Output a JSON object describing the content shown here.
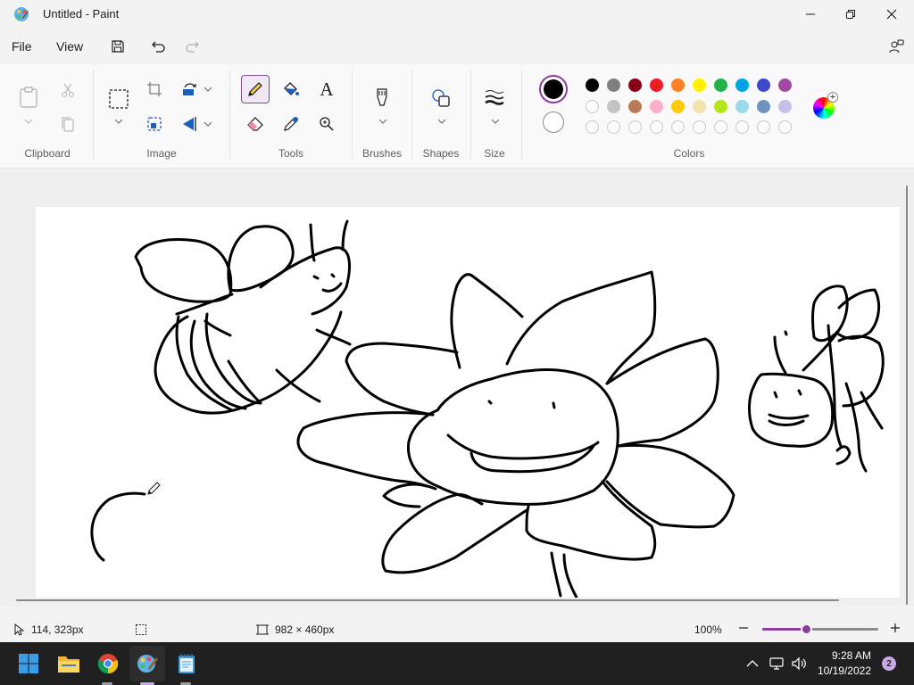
{
  "window": {
    "title": "Untitled - Paint",
    "controls": [
      "minimize",
      "maximize",
      "close"
    ]
  },
  "menu": {
    "items": [
      "File",
      "View"
    ],
    "quick_actions": [
      "save-icon",
      "undo-icon",
      "redo-icon"
    ],
    "share_icon": "share-icon"
  },
  "ribbon": {
    "groups": {
      "clipboard": "Clipboard",
      "image": "Image",
      "tools": "Tools",
      "brushes": "Brushes",
      "shapes": "Shapes",
      "size": "Size",
      "colors": "Colors"
    },
    "active_tool": "pencil",
    "text_tool_label": "A"
  },
  "colors": {
    "primary": "#000000",
    "secondary": "#ffffff",
    "palette_row1": [
      "#000000",
      "#7f7f7f",
      "#880015",
      "#ed1c24",
      "#ff7f27",
      "#fff200",
      "#22b14c",
      "#00a2e8",
      "#3f48cc",
      "#a349a4"
    ],
    "palette_row2": [
      "#ffffff",
      "#c3c3c3",
      "#b97a57",
      "#ffaec9",
      "#ffc90e",
      "#efe4b0",
      "#b5e61d",
      "#99d9ea",
      "#7092be",
      "#c8bfe7"
    ],
    "palette_row3_empty": 10,
    "accent": "#8a3d9c"
  },
  "status": {
    "cursor_pos": "114, 323px",
    "canvas_size": "982 × 460px",
    "zoom": "100%",
    "zoom_fraction": 0.38
  },
  "taskbar": {
    "apps": [
      "start-icon",
      "file-explorer-icon",
      "chrome-icon",
      "paint-icon",
      "notepad-icon"
    ],
    "time": "9:28 AM",
    "date": "10/19/2022",
    "notification_count": "2"
  }
}
